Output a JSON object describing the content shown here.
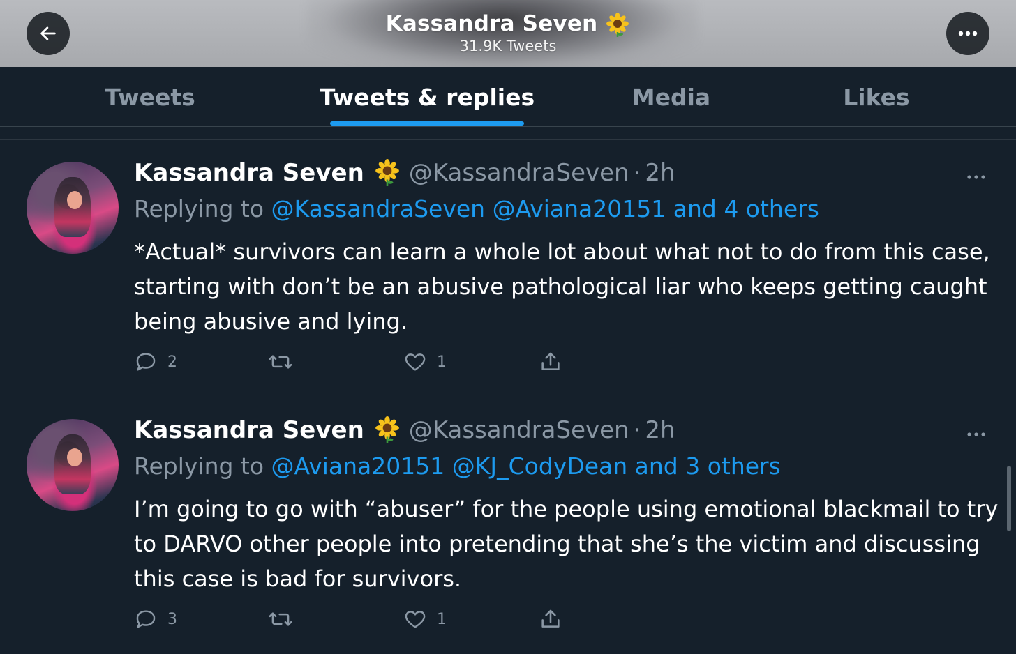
{
  "header": {
    "title": "Kassandra Seven",
    "tweet_count": "31.9K Tweets",
    "back_icon": "arrow-left-icon",
    "more_icon": "ellipsis-icon"
  },
  "tabs": [
    {
      "label": "Tweets",
      "active": false
    },
    {
      "label": "Tweets & replies",
      "active": true
    },
    {
      "label": "Media",
      "active": false
    },
    {
      "label": "Likes",
      "active": false
    }
  ],
  "colors": {
    "background": "#15202b",
    "accent": "#1d9bf0",
    "secondary_text": "#8b98a5",
    "divider": "#38444d"
  },
  "tweets": [
    {
      "name": "Kassandra Seven",
      "handle": "@KassandraSeven",
      "separator": "·",
      "time": "2h",
      "replying_prefix": "Replying to",
      "replying_links": "@KassandraSeven @Aviana20151 and 4 others",
      "text": "*Actual* survivors can learn a whole lot about what not to do from this case, starting with don’t be an abusive pathological liar who keeps getting caught being abusive and lying.",
      "replies": "2",
      "retweets": "",
      "likes": "1"
    },
    {
      "name": "Kassandra Seven",
      "handle": "@KassandraSeven",
      "separator": "·",
      "time": "2h",
      "replying_prefix": "Replying to",
      "replying_links": "@Aviana20151 @KJ_CodyDean and 3 others",
      "text": "I’m going to go with “abuser” for the people using emotional blackmail to try to DARVO other people into pretending that she’s the victim and discussing this case is bad for survivors.",
      "replies": "3",
      "retweets": "",
      "likes": "1"
    }
  ]
}
